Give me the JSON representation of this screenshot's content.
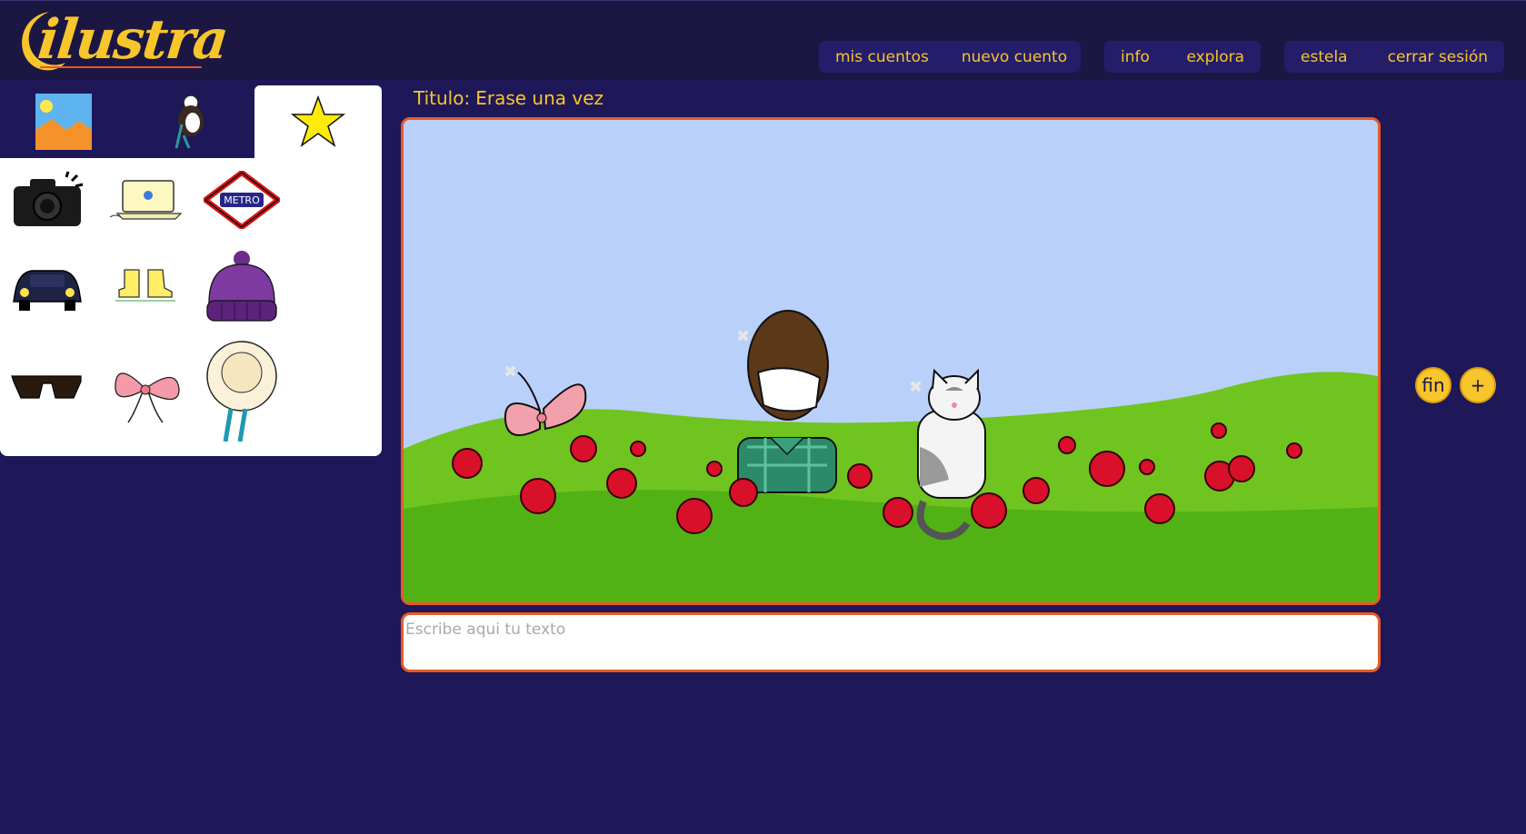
{
  "app": {
    "logo_text": "ilustra"
  },
  "nav": {
    "groups": [
      [
        "mis cuentos",
        "nuevo cuento"
      ],
      [
        "info",
        "explora"
      ],
      [
        "estela",
        "cerrar sesión"
      ]
    ]
  },
  "sidebar": {
    "tabs": [
      {
        "icon": "landscape-icon",
        "active": false
      },
      {
        "icon": "character-icon",
        "active": false
      },
      {
        "icon": "star-icon",
        "active": true
      }
    ],
    "items": [
      {
        "icon": "camera-icon"
      },
      {
        "icon": "laptop-icon"
      },
      {
        "icon": "metro-sign-icon",
        "label": "METRO"
      },
      {
        "icon": "car-icon"
      },
      {
        "icon": "boots-icon"
      },
      {
        "icon": "beanie-hat-icon"
      },
      {
        "icon": "sunglasses-icon"
      },
      {
        "icon": "bow-icon"
      },
      {
        "icon": "straw-hat-icon"
      }
    ]
  },
  "story": {
    "title_label": "Titulo:",
    "title_value": "Erase una vez",
    "text_placeholder": "Escribe aqui tu texto"
  },
  "actions": {
    "finish_label": "fin",
    "add_label": "+"
  },
  "colors": {
    "background": "#1e1858",
    "topbar": "#1c1643",
    "accent": "#f7c52c",
    "canvas_border": "#e85a24",
    "sky": "#b9d0fa",
    "grass": "#6cc41e"
  }
}
